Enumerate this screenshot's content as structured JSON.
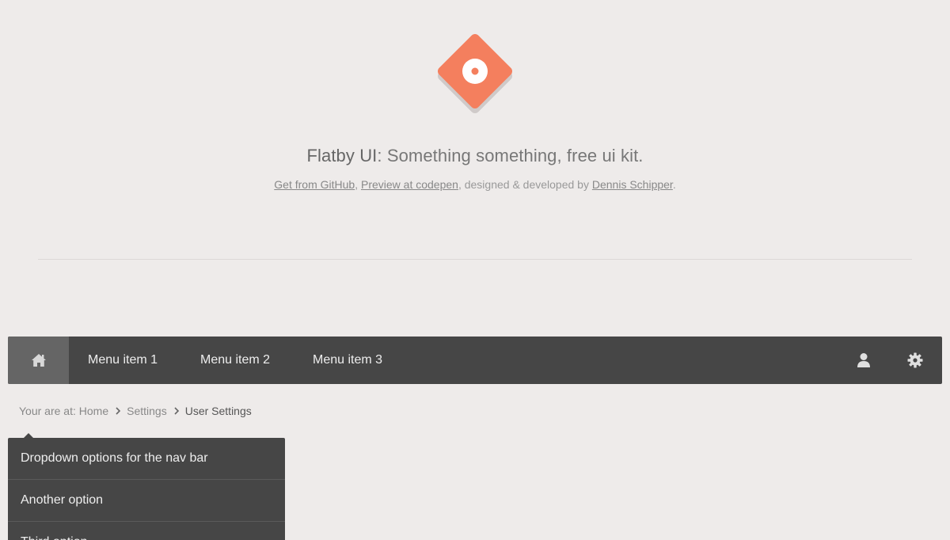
{
  "header": {
    "brand": "Flatby UI",
    "tagline_rest": ": Something something, free ui kit.",
    "link_github": "Get from GitHub",
    "sep1": ", ",
    "link_codepen": "Preview at codepen",
    "sep2": ", designed & developed by ",
    "link_author": "Dennis Schipper",
    "end": ".",
    "logo_color": "#f47f5e"
  },
  "navbar": {
    "home_icon": "home-icon",
    "items": [
      "Menu item 1",
      "Menu item 2",
      "Menu item 3"
    ],
    "right_icons": [
      "user-icon",
      "gear-icon"
    ],
    "bg_color": "#464646",
    "active_bg": "#656565"
  },
  "breadcrumb": {
    "prefix": "Your are at:",
    "items": [
      "Home",
      "Settings",
      "User Settings"
    ]
  },
  "dropdown": {
    "items": [
      "Dropdown options for the nav bar",
      "Another option",
      "Third option"
    ]
  }
}
